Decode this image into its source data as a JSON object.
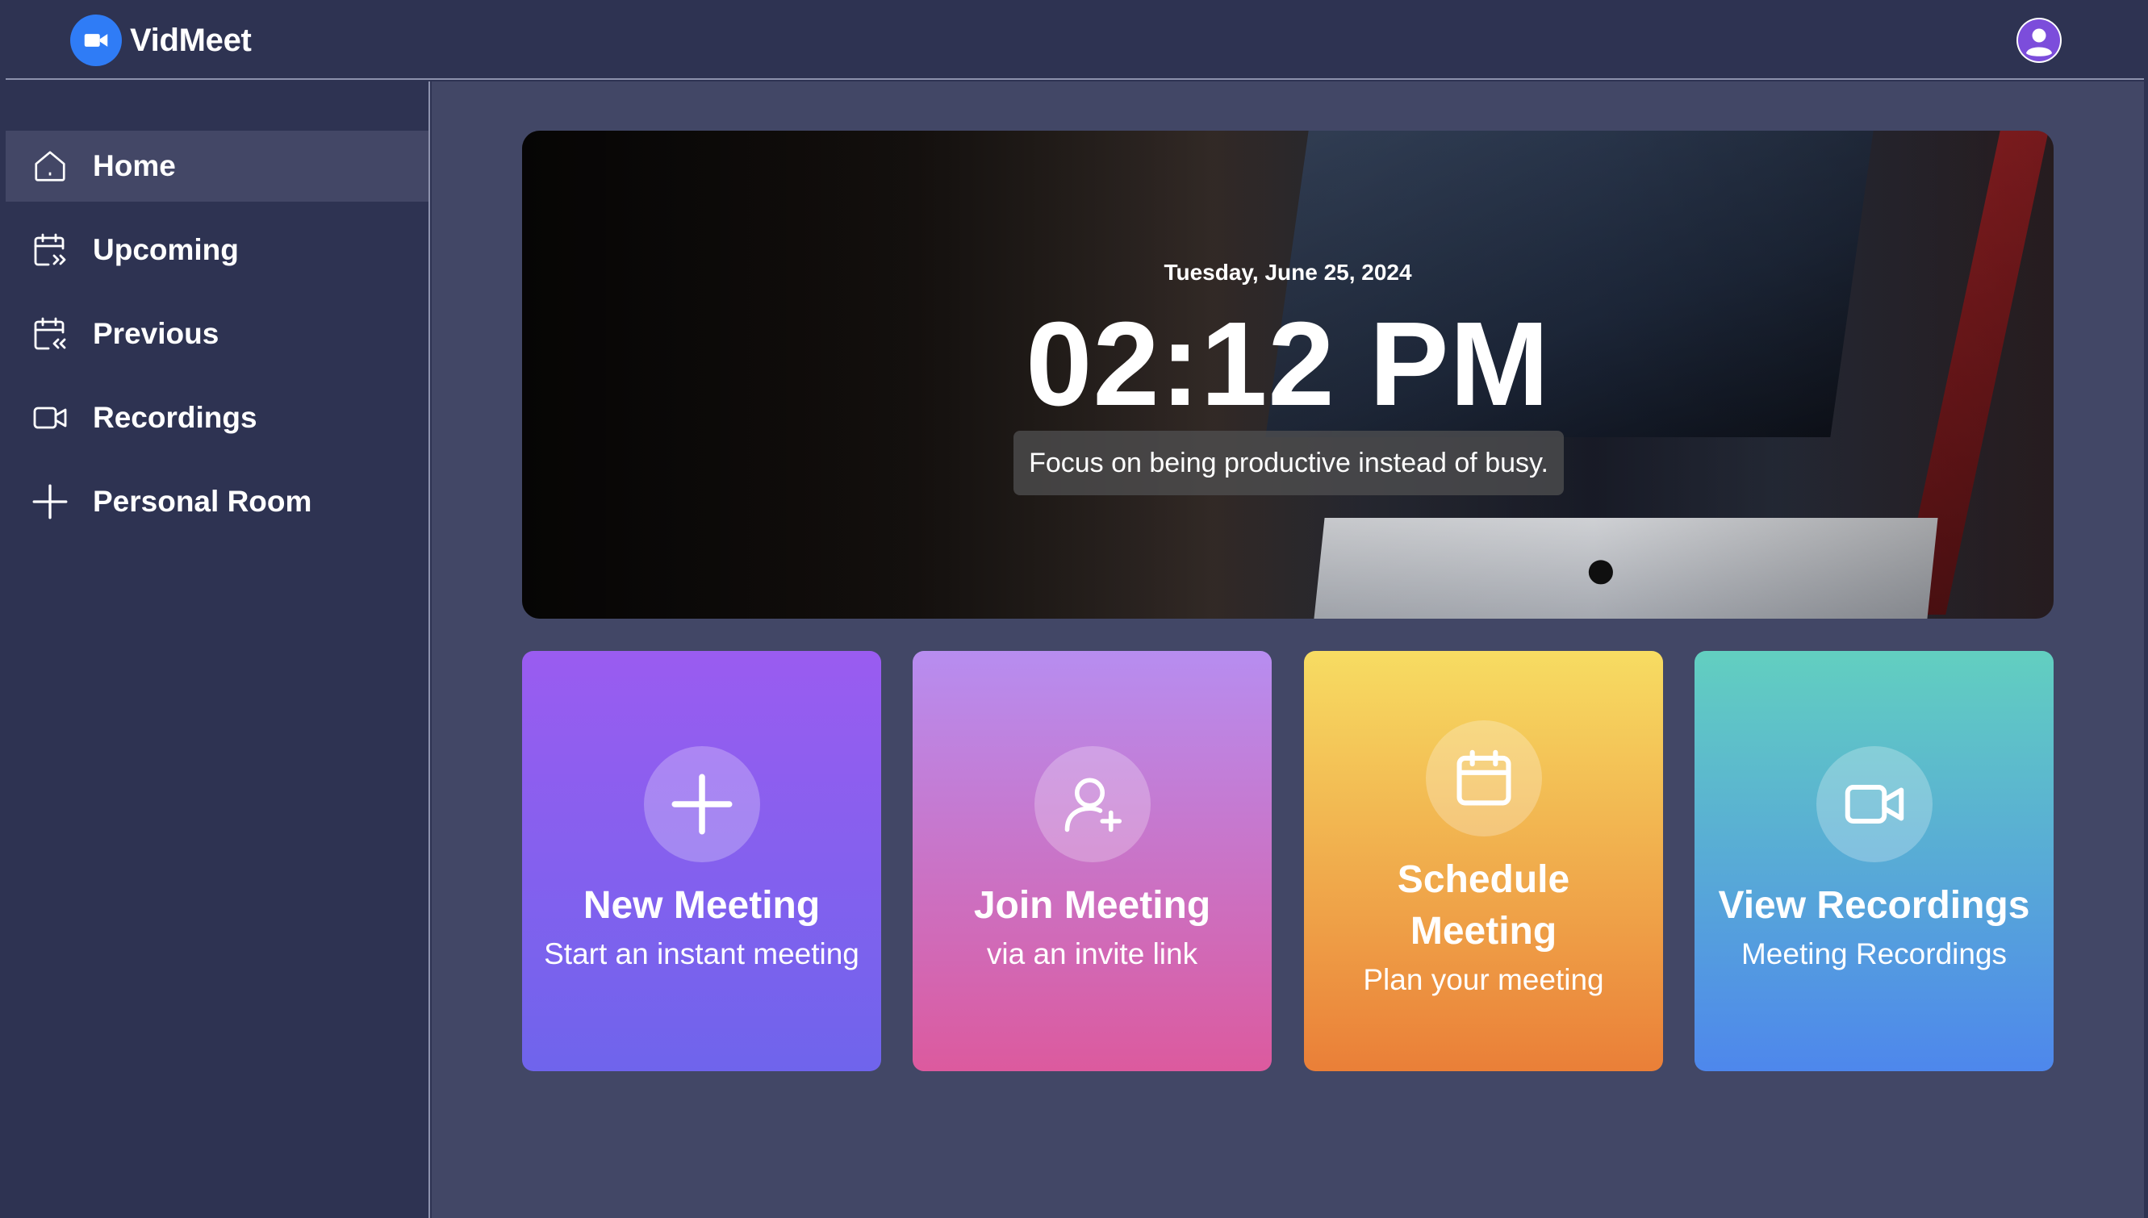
{
  "header": {
    "brand_name": "VidMeet"
  },
  "sidebar": {
    "items": [
      {
        "label": "Home",
        "icon": "home-icon",
        "active": true
      },
      {
        "label": "Upcoming",
        "icon": "calendar-forward-icon"
      },
      {
        "label": "Previous",
        "icon": "calendar-back-icon"
      },
      {
        "label": "Recordings",
        "icon": "video-icon"
      },
      {
        "label": "Personal Room",
        "icon": "plus-icon"
      }
    ]
  },
  "hero": {
    "date": "Tuesday, June 25, 2024",
    "time": "02:12 PM",
    "quote": "Focus on being productive instead of busy."
  },
  "cards": [
    {
      "title": "New Meeting",
      "subtitle": "Start an instant meeting",
      "icon": "plus-icon",
      "color": "#8b5cf6"
    },
    {
      "title": "Join Meeting",
      "subtitle": "via an invite link",
      "icon": "user-plus-icon",
      "color": "#d46bb8"
    },
    {
      "title": "Schedule Meeting",
      "subtitle": "Plan your meeting",
      "icon": "calendar-icon",
      "color": "#f0a545"
    },
    {
      "title": "View Recordings",
      "subtitle": "Meeting Recordings",
      "icon": "video-icon",
      "color": "#56a6dc"
    }
  ]
}
